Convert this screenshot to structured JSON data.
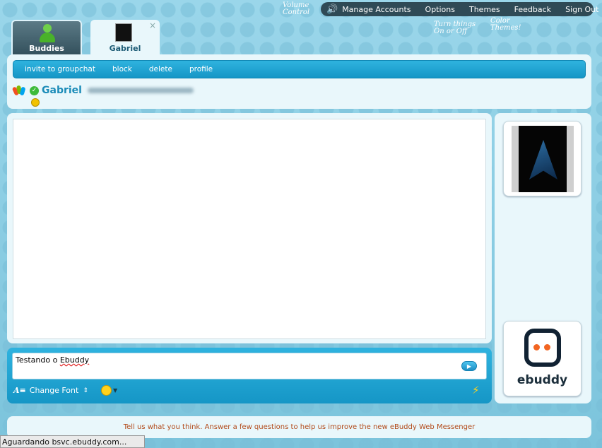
{
  "topbar": {
    "volume_icon": "speaker-icon",
    "items": [
      "Manage Accounts",
      "Options",
      "Themes",
      "Feedback",
      "Sign Out"
    ]
  },
  "hints": {
    "volume_control": "Volume Control",
    "options": "Turn things On or Off",
    "themes": "Color Themes!"
  },
  "tabs": {
    "buddies": "Buddies",
    "gabriel": "Gabriel",
    "close": "×"
  },
  "actions": [
    "invite to groupchat",
    "block",
    "delete",
    "profile"
  ],
  "contact": {
    "name": "Gabriel",
    "status_color": "#3dbb3a"
  },
  "message_input": {
    "value": "Testando o Ebuddy",
    "value_before": "Testando o ",
    "value_misspelled": "Ebuddy"
  },
  "toolbar": {
    "change_font": "Change Font",
    "font_icon": "A≡",
    "spinner": "⇕"
  },
  "sidebar": {
    "brand": "ebuddy"
  },
  "feedback": "Tell us what you think. Answer a few questions to help us improve the new eBuddy Web Messenger",
  "statusbar": "Aguardando bsvc.ebuddy.com..."
}
